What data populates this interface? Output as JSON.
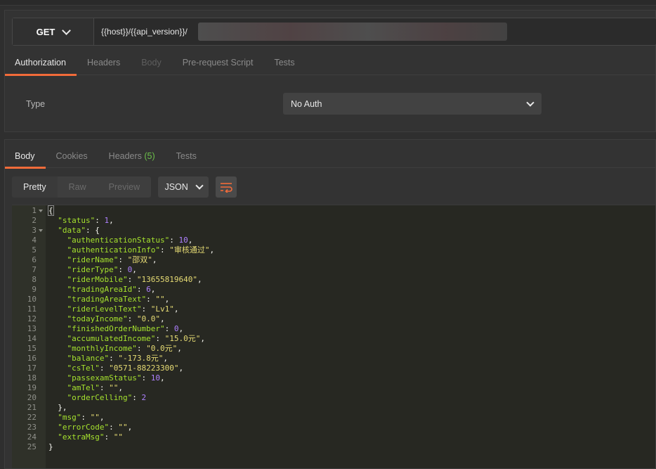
{
  "request": {
    "method": "GET",
    "url": "{{host}}/{{api_version}}/",
    "tabs": [
      {
        "label": "Authorization",
        "state": "active"
      },
      {
        "label": "Headers",
        "state": "normal"
      },
      {
        "label": "Body",
        "state": "disabled"
      },
      {
        "label": "Pre-request Script",
        "state": "normal"
      },
      {
        "label": "Tests",
        "state": "normal"
      }
    ],
    "auth": {
      "type_label": "Type",
      "type_value": "No Auth"
    }
  },
  "response": {
    "tabs": [
      {
        "label": "Body",
        "state": "active"
      },
      {
        "label": "Cookies",
        "state": "normal"
      },
      {
        "label": "Headers",
        "badge": "(5)",
        "state": "normal"
      },
      {
        "label": "Tests",
        "state": "normal"
      }
    ],
    "view_modes": [
      "Pretty",
      "Raw",
      "Preview"
    ],
    "active_view": "Pretty",
    "format": "JSON",
    "icons": {
      "format_chevron": "chevron-down-icon",
      "wrap": "wrap-lines-icon",
      "method_chevron": "chevron-down-icon"
    },
    "code_lines": [
      {
        "num": "1",
        "fold": true,
        "tokens": [
          [
            "p",
            "{"
          ]
        ]
      },
      {
        "num": "2",
        "tokens": [
          [
            "p",
            "  "
          ],
          [
            "k",
            "\"status\""
          ],
          [
            "p",
            ": "
          ],
          [
            "n",
            "1"
          ],
          [
            "p",
            ","
          ]
        ]
      },
      {
        "num": "3",
        "fold": true,
        "tokens": [
          [
            "p",
            "  "
          ],
          [
            "k",
            "\"data\""
          ],
          [
            "p",
            ": {"
          ]
        ]
      },
      {
        "num": "4",
        "tokens": [
          [
            "p",
            "    "
          ],
          [
            "k",
            "\"authenticationStatus\""
          ],
          [
            "p",
            ": "
          ],
          [
            "n",
            "10"
          ],
          [
            "p",
            ","
          ]
        ]
      },
      {
        "num": "5",
        "tokens": [
          [
            "p",
            "    "
          ],
          [
            "k",
            "\"authenticationInfo\""
          ],
          [
            "p",
            ": "
          ],
          [
            "s",
            "\"审核通过\""
          ],
          [
            "p",
            ","
          ]
        ]
      },
      {
        "num": "6",
        "tokens": [
          [
            "p",
            "    "
          ],
          [
            "k",
            "\"riderName\""
          ],
          [
            "p",
            ": "
          ],
          [
            "s",
            "\"邵双\""
          ],
          [
            "p",
            ","
          ]
        ]
      },
      {
        "num": "7",
        "tokens": [
          [
            "p",
            "    "
          ],
          [
            "k",
            "\"riderType\""
          ],
          [
            "p",
            ": "
          ],
          [
            "n",
            "0"
          ],
          [
            "p",
            ","
          ]
        ]
      },
      {
        "num": "8",
        "tokens": [
          [
            "p",
            "    "
          ],
          [
            "k",
            "\"riderMobile\""
          ],
          [
            "p",
            ": "
          ],
          [
            "s",
            "\"13655819640\""
          ],
          [
            "p",
            ","
          ]
        ]
      },
      {
        "num": "9",
        "tokens": [
          [
            "p",
            "    "
          ],
          [
            "k",
            "\"tradingAreaId\""
          ],
          [
            "p",
            ": "
          ],
          [
            "n",
            "6"
          ],
          [
            "p",
            ","
          ]
        ]
      },
      {
        "num": "10",
        "tokens": [
          [
            "p",
            "    "
          ],
          [
            "k",
            "\"tradingAreaText\""
          ],
          [
            "p",
            ": "
          ],
          [
            "s",
            "\"\""
          ],
          [
            "p",
            ","
          ]
        ]
      },
      {
        "num": "11",
        "tokens": [
          [
            "p",
            "    "
          ],
          [
            "k",
            "\"riderLevelText\""
          ],
          [
            "p",
            ": "
          ],
          [
            "s",
            "\"Lv1\""
          ],
          [
            "p",
            ","
          ]
        ]
      },
      {
        "num": "12",
        "tokens": [
          [
            "p",
            "    "
          ],
          [
            "k",
            "\"todayIncome\""
          ],
          [
            "p",
            ": "
          ],
          [
            "s",
            "\"0.0\""
          ],
          [
            "p",
            ","
          ]
        ]
      },
      {
        "num": "13",
        "tokens": [
          [
            "p",
            "    "
          ],
          [
            "k",
            "\"finishedOrderNumber\""
          ],
          [
            "p",
            ": "
          ],
          [
            "n",
            "0"
          ],
          [
            "p",
            ","
          ]
        ]
      },
      {
        "num": "14",
        "tokens": [
          [
            "p",
            "    "
          ],
          [
            "k",
            "\"accumulatedIncome\""
          ],
          [
            "p",
            ": "
          ],
          [
            "s",
            "\"15.0元\""
          ],
          [
            "p",
            ","
          ]
        ]
      },
      {
        "num": "15",
        "tokens": [
          [
            "p",
            "    "
          ],
          [
            "k",
            "\"monthlyIncome\""
          ],
          [
            "p",
            ": "
          ],
          [
            "s",
            "\"0.0元\""
          ],
          [
            "p",
            ","
          ]
        ]
      },
      {
        "num": "16",
        "tokens": [
          [
            "p",
            "    "
          ],
          [
            "k",
            "\"balance\""
          ],
          [
            "p",
            ": "
          ],
          [
            "s",
            "\"-173.8元\""
          ],
          [
            "p",
            ","
          ]
        ]
      },
      {
        "num": "17",
        "tokens": [
          [
            "p",
            "    "
          ],
          [
            "k",
            "\"csTel\""
          ],
          [
            "p",
            ": "
          ],
          [
            "s",
            "\"0571-88223300\""
          ],
          [
            "p",
            ","
          ]
        ]
      },
      {
        "num": "18",
        "tokens": [
          [
            "p",
            "    "
          ],
          [
            "k",
            "\"passexamStatus\""
          ],
          [
            "p",
            ": "
          ],
          [
            "n",
            "10"
          ],
          [
            "p",
            ","
          ]
        ]
      },
      {
        "num": "19",
        "tokens": [
          [
            "p",
            "    "
          ],
          [
            "k",
            "\"amTel\""
          ],
          [
            "p",
            ": "
          ],
          [
            "s",
            "\"\""
          ],
          [
            "p",
            ","
          ]
        ]
      },
      {
        "num": "20",
        "tokens": [
          [
            "p",
            "    "
          ],
          [
            "k",
            "\"orderCelling\""
          ],
          [
            "p",
            ": "
          ],
          [
            "n",
            "2"
          ]
        ]
      },
      {
        "num": "21",
        "tokens": [
          [
            "p",
            "  },"
          ]
        ]
      },
      {
        "num": "22",
        "tokens": [
          [
            "p",
            "  "
          ],
          [
            "k",
            "\"msg\""
          ],
          [
            "p",
            ": "
          ],
          [
            "s",
            "\"\""
          ],
          [
            "p",
            ","
          ]
        ]
      },
      {
        "num": "23",
        "tokens": [
          [
            "p",
            "  "
          ],
          [
            "k",
            "\"errorCode\""
          ],
          [
            "p",
            ": "
          ],
          [
            "s",
            "\"\""
          ],
          [
            "p",
            ","
          ]
        ]
      },
      {
        "num": "24",
        "tokens": [
          [
            "p",
            "  "
          ],
          [
            "k",
            "\"extraMsg\""
          ],
          [
            "p",
            ": "
          ],
          [
            "s",
            "\"\""
          ]
        ]
      },
      {
        "num": "25",
        "tokens": [
          [
            "p",
            "}"
          ]
        ]
      }
    ]
  },
  "colors": {
    "accent": "#f26b3a",
    "badge_green": "#6cc04a",
    "json_key": "#a6e22e",
    "json_string": "#e6db74",
    "json_number": "#ae81ff"
  }
}
